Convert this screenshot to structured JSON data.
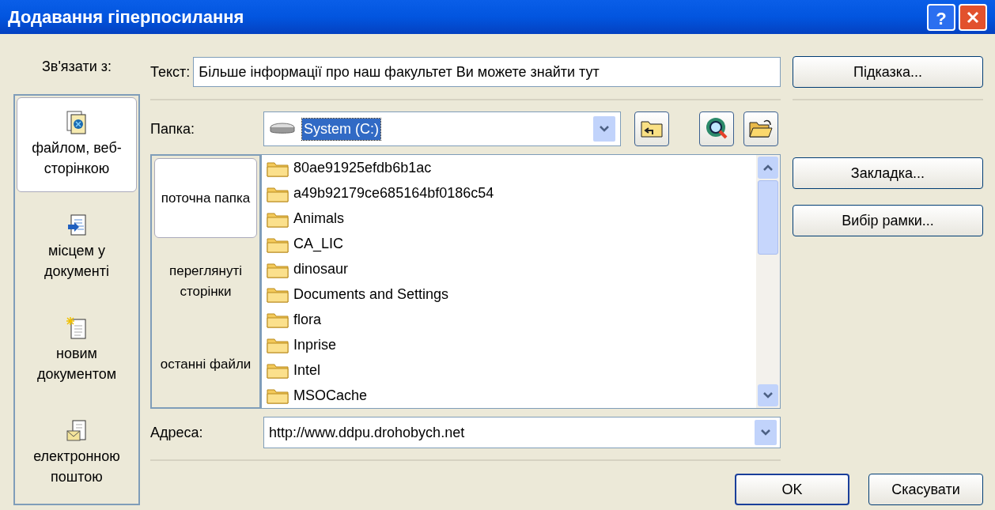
{
  "window": {
    "title": "Додавання гіперпосилання",
    "help": "?"
  },
  "link_to": {
    "label": "Зв'язати з:",
    "items": [
      {
        "kind": "file",
        "label": "файлом, веб-сторінкою",
        "selected": true
      },
      {
        "kind": "place",
        "label": "місцем у документі",
        "selected": false
      },
      {
        "kind": "new",
        "label": "новим документом",
        "selected": false
      },
      {
        "kind": "email",
        "label": "електронною поштою",
        "selected": false
      }
    ]
  },
  "text_field": {
    "label": "Текст:",
    "value": "Більше інформації про наш факультет Ви можете знайти тут"
  },
  "folder": {
    "label": "Папка:",
    "value": "System (C:)"
  },
  "browse_tabs": [
    {
      "label": "поточна папка",
      "selected": true
    },
    {
      "label": "переглянуті сторінки",
      "selected": false
    },
    {
      "label": "останні файли",
      "selected": false
    }
  ],
  "files": [
    "80ae91925efdb6b1ac",
    "a49b92179ce685164bf0186c54",
    "Animals",
    "CA_LIC",
    "dinosaur",
    "Documents and Settings",
    "flora",
    "Inprise",
    "Intel",
    "MSOCache"
  ],
  "address": {
    "label": "Адреса:",
    "value": "http://www.ddpu.drohobych.net"
  },
  "side_buttons": [
    {
      "label": "Підказка..."
    },
    {
      "label": "Закладка..."
    },
    {
      "label": "Вибір рамки..."
    }
  ],
  "footer_buttons": [
    {
      "label": "OK",
      "default": true
    },
    {
      "label": "Скасувати",
      "default": false
    }
  ]
}
